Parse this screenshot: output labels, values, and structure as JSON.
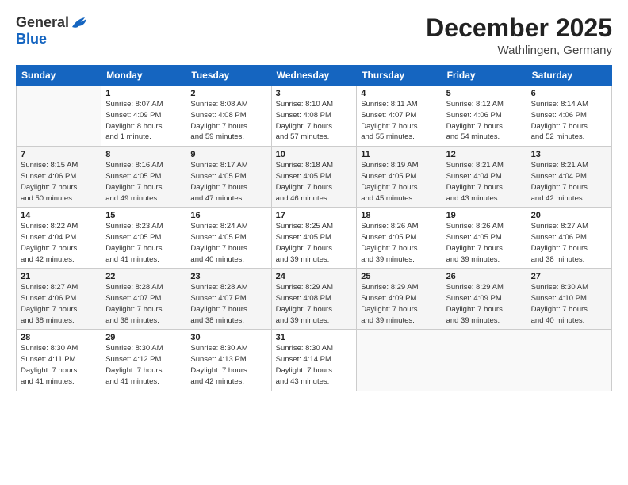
{
  "logo": {
    "general": "General",
    "blue": "Blue"
  },
  "title": "December 2025",
  "location": "Wathlingen, Germany",
  "weekdays": [
    "Sunday",
    "Monday",
    "Tuesday",
    "Wednesday",
    "Thursday",
    "Friday",
    "Saturday"
  ],
  "weeks": [
    [
      {
        "day": "",
        "info": ""
      },
      {
        "day": "1",
        "info": "Sunrise: 8:07 AM\nSunset: 4:09 PM\nDaylight: 8 hours\nand 1 minute."
      },
      {
        "day": "2",
        "info": "Sunrise: 8:08 AM\nSunset: 4:08 PM\nDaylight: 7 hours\nand 59 minutes."
      },
      {
        "day": "3",
        "info": "Sunrise: 8:10 AM\nSunset: 4:08 PM\nDaylight: 7 hours\nand 57 minutes."
      },
      {
        "day": "4",
        "info": "Sunrise: 8:11 AM\nSunset: 4:07 PM\nDaylight: 7 hours\nand 55 minutes."
      },
      {
        "day": "5",
        "info": "Sunrise: 8:12 AM\nSunset: 4:06 PM\nDaylight: 7 hours\nand 54 minutes."
      },
      {
        "day": "6",
        "info": "Sunrise: 8:14 AM\nSunset: 4:06 PM\nDaylight: 7 hours\nand 52 minutes."
      }
    ],
    [
      {
        "day": "7",
        "info": "Sunrise: 8:15 AM\nSunset: 4:06 PM\nDaylight: 7 hours\nand 50 minutes."
      },
      {
        "day": "8",
        "info": "Sunrise: 8:16 AM\nSunset: 4:05 PM\nDaylight: 7 hours\nand 49 minutes."
      },
      {
        "day": "9",
        "info": "Sunrise: 8:17 AM\nSunset: 4:05 PM\nDaylight: 7 hours\nand 47 minutes."
      },
      {
        "day": "10",
        "info": "Sunrise: 8:18 AM\nSunset: 4:05 PM\nDaylight: 7 hours\nand 46 minutes."
      },
      {
        "day": "11",
        "info": "Sunrise: 8:19 AM\nSunset: 4:05 PM\nDaylight: 7 hours\nand 45 minutes."
      },
      {
        "day": "12",
        "info": "Sunrise: 8:21 AM\nSunset: 4:04 PM\nDaylight: 7 hours\nand 43 minutes."
      },
      {
        "day": "13",
        "info": "Sunrise: 8:21 AM\nSunset: 4:04 PM\nDaylight: 7 hours\nand 42 minutes."
      }
    ],
    [
      {
        "day": "14",
        "info": "Sunrise: 8:22 AM\nSunset: 4:04 PM\nDaylight: 7 hours\nand 42 minutes."
      },
      {
        "day": "15",
        "info": "Sunrise: 8:23 AM\nSunset: 4:05 PM\nDaylight: 7 hours\nand 41 minutes."
      },
      {
        "day": "16",
        "info": "Sunrise: 8:24 AM\nSunset: 4:05 PM\nDaylight: 7 hours\nand 40 minutes."
      },
      {
        "day": "17",
        "info": "Sunrise: 8:25 AM\nSunset: 4:05 PM\nDaylight: 7 hours\nand 39 minutes."
      },
      {
        "day": "18",
        "info": "Sunrise: 8:26 AM\nSunset: 4:05 PM\nDaylight: 7 hours\nand 39 minutes."
      },
      {
        "day": "19",
        "info": "Sunrise: 8:26 AM\nSunset: 4:05 PM\nDaylight: 7 hours\nand 39 minutes."
      },
      {
        "day": "20",
        "info": "Sunrise: 8:27 AM\nSunset: 4:06 PM\nDaylight: 7 hours\nand 38 minutes."
      }
    ],
    [
      {
        "day": "21",
        "info": "Sunrise: 8:27 AM\nSunset: 4:06 PM\nDaylight: 7 hours\nand 38 minutes."
      },
      {
        "day": "22",
        "info": "Sunrise: 8:28 AM\nSunset: 4:07 PM\nDaylight: 7 hours\nand 38 minutes."
      },
      {
        "day": "23",
        "info": "Sunrise: 8:28 AM\nSunset: 4:07 PM\nDaylight: 7 hours\nand 38 minutes."
      },
      {
        "day": "24",
        "info": "Sunrise: 8:29 AM\nSunset: 4:08 PM\nDaylight: 7 hours\nand 39 minutes."
      },
      {
        "day": "25",
        "info": "Sunrise: 8:29 AM\nSunset: 4:09 PM\nDaylight: 7 hours\nand 39 minutes."
      },
      {
        "day": "26",
        "info": "Sunrise: 8:29 AM\nSunset: 4:09 PM\nDaylight: 7 hours\nand 39 minutes."
      },
      {
        "day": "27",
        "info": "Sunrise: 8:30 AM\nSunset: 4:10 PM\nDaylight: 7 hours\nand 40 minutes."
      }
    ],
    [
      {
        "day": "28",
        "info": "Sunrise: 8:30 AM\nSunset: 4:11 PM\nDaylight: 7 hours\nand 41 minutes."
      },
      {
        "day": "29",
        "info": "Sunrise: 8:30 AM\nSunset: 4:12 PM\nDaylight: 7 hours\nand 41 minutes."
      },
      {
        "day": "30",
        "info": "Sunrise: 8:30 AM\nSunset: 4:13 PM\nDaylight: 7 hours\nand 42 minutes."
      },
      {
        "day": "31",
        "info": "Sunrise: 8:30 AM\nSunset: 4:14 PM\nDaylight: 7 hours\nand 43 minutes."
      },
      {
        "day": "",
        "info": ""
      },
      {
        "day": "",
        "info": ""
      },
      {
        "day": "",
        "info": ""
      }
    ]
  ]
}
